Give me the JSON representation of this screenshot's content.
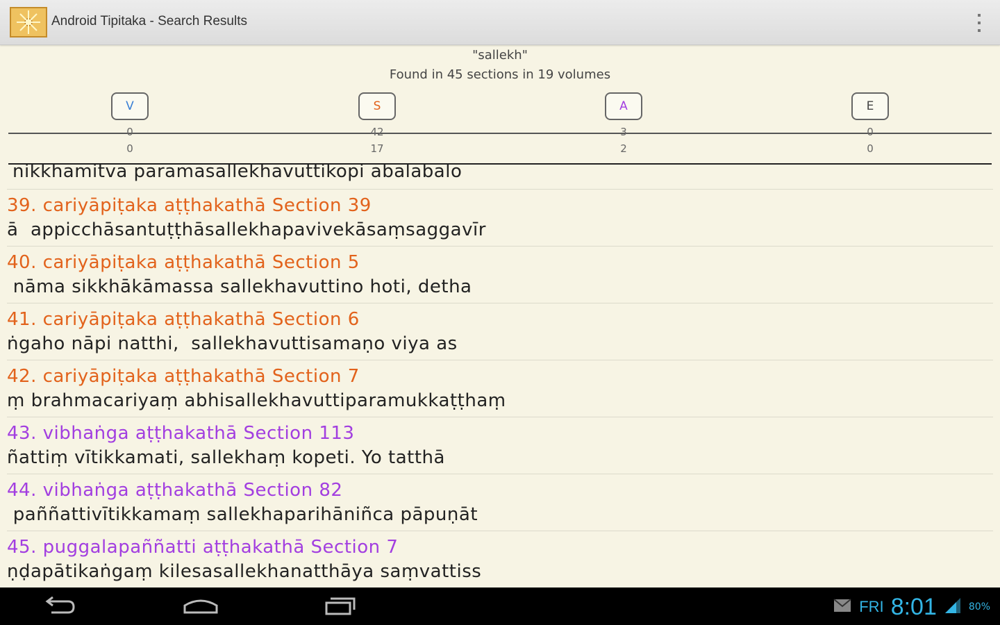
{
  "app": {
    "title": "Android Tipitaka - Search Results",
    "icon": "dhamma-wheel-icon"
  },
  "search": {
    "query": "\"sallekh\"",
    "summary": "Found in 45 sections in 19 volumes"
  },
  "columns": [
    {
      "label": "V",
      "color": "#3a7fd5",
      "sections": "0",
      "volumes": "0"
    },
    {
      "label": "S",
      "color": "#e2621b",
      "sections": "42",
      "volumes": "17"
    },
    {
      "label": "A",
      "color": "#a23ee0",
      "sections": "3",
      "volumes": "2"
    },
    {
      "label": "E",
      "color": "#444444",
      "sections": "0",
      "volumes": "0"
    }
  ],
  "results": {
    "partial_snippet": "nikkhamitva  paramasallekhavuttikopi abalabalo",
    "items": [
      {
        "title": "39. cariyāpiṭaka aṭṭhakathā  Section 39",
        "color": "#e2621b",
        "snippet": "ā  appicchāsantuṭṭhāsallekhapavivekāsaṃsaggavīr"
      },
      {
        "title": "40. cariyāpiṭaka aṭṭhakathā  Section 5",
        "color": "#e2621b",
        "snippet": " nāma sikkhākāmassa sallekhavuttino hoti, detha"
      },
      {
        "title": "41. cariyāpiṭaka aṭṭhakathā  Section 6",
        "color": "#e2621b",
        "snippet": "ṅgaho nāpi natthi,  sallekhavuttisamaṇo viya as"
      },
      {
        "title": "42. cariyāpiṭaka aṭṭhakathā  Section 7",
        "color": "#e2621b",
        "snippet": "ṃ brahmacariyaṃ abhisallekhavuttiparamukkaṭṭhaṃ"
      },
      {
        "title": "43. vibhaṅga aṭṭhakathā  Section 113",
        "color": "#a23ee0",
        "snippet": "ñattiṃ vītikkamati, sallekhaṃ kopeti. Yo tatthā"
      },
      {
        "title": "44. vibhaṅga aṭṭhakathā  Section 82",
        "color": "#a23ee0",
        "snippet": " paññattivītikkamaṃ sallekhaparihāniñca pāpuṇāt"
      },
      {
        "title": "45. puggalapaññatti aṭṭhakathā  Section 7",
        "color": "#a23ee0",
        "snippet": "ṇḍapātikaṅgaṃ kilesasallekhanatthāya saṃvattiss"
      }
    ]
  },
  "navbar": {
    "back_icon": "back-icon",
    "home_icon": "home-icon",
    "recents_icon": "recent-apps-icon"
  },
  "status": {
    "day": "FRI",
    "time": "8:01",
    "battery": "80%",
    "icons": [
      "notification-mail-icon",
      "signal-icon",
      "battery-icon"
    ]
  },
  "colors": {
    "background": "#f7f4e4",
    "accent_time": "#33b5e5"
  }
}
